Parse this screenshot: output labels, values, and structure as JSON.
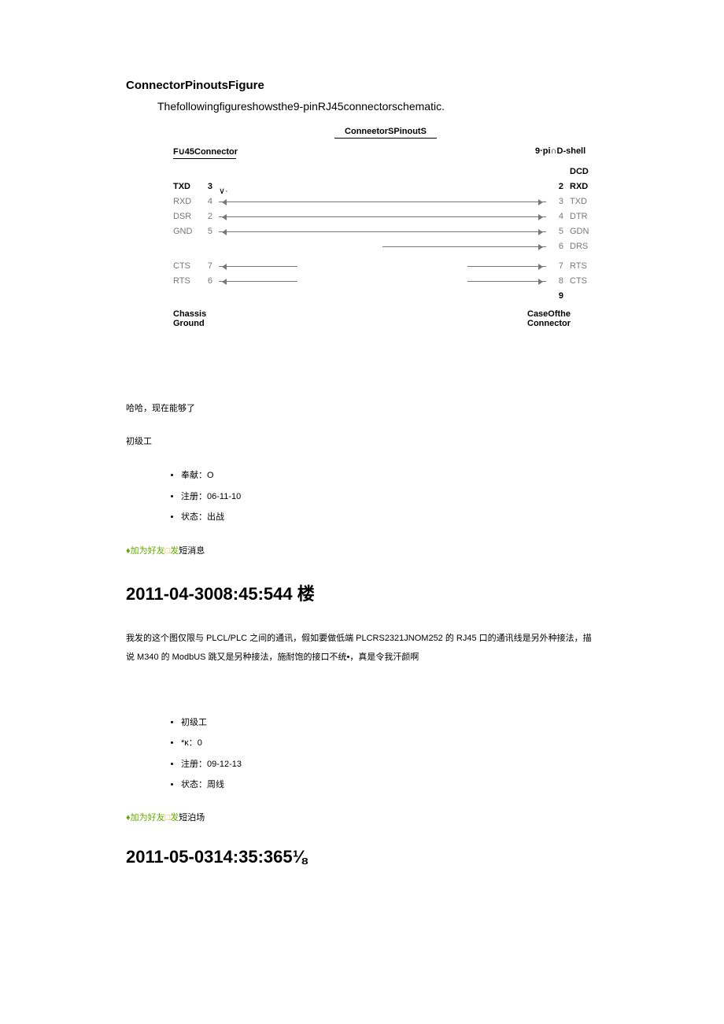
{
  "section_title": "ConnectorPinoutsFigure",
  "intro_text": "Thefollowingfigureshowsthe9-pinRJ45connectorschematic.",
  "diagram": {
    "title": "ConneetorSPinoutS",
    "left_header": "F∪45Connector",
    "right_header": "9·pi∩D-shell",
    "left_pins": [
      {
        "label": "TXD",
        "num": "3",
        "extra": "∨·"
      },
      {
        "label": "RXD",
        "num": "4"
      },
      {
        "label": "DSR",
        "num": "2"
      },
      {
        "label": "GND",
        "num": "5"
      },
      {
        "label": "",
        "num": ""
      },
      {
        "label": "CTS",
        "num": "7"
      },
      {
        "label": "RTS",
        "num": "6"
      }
    ],
    "right_pins": [
      {
        "num": "",
        "label": "DCD"
      },
      {
        "num": "2",
        "label": "RXD"
      },
      {
        "num": "3",
        "label": "TXD"
      },
      {
        "num": "4",
        "label": "DTR"
      },
      {
        "num": "5",
        "label": "GDN"
      },
      {
        "num": "6",
        "label": "DRS"
      },
      {
        "num": "7",
        "label": "RTS"
      },
      {
        "num": "8",
        "label": "CTS"
      },
      {
        "num": "9",
        "label": ""
      }
    ],
    "footer_left": "Chassis Ground",
    "footer_right": "CaseOfthe Connector"
  },
  "post3": {
    "reply_text": "哈哈，现在能够了",
    "rank": "初级工",
    "bullets": [
      "奉献：O",
      "注册：06-11-10",
      "状态：出战"
    ],
    "action_prefix": "♦",
    "action_add": "加为好友",
    "action_square": "□",
    "action_send": "发",
    "action_msg": "短消息"
  },
  "post4": {
    "heading": "2011-04-3008:45:544 楼",
    "body": "我发的这个图仅限与 PLCL/PLC 之间的通讯，假如要做低端 PLCRS2321JNOM252 的 RJ45 口的通讯线是另外种接法，描说 M340 的 ModbUS 跳又是另种接法，施耐饱的接口不统•，真是令我汗颜啊",
    "bullets": [
      "初级工",
      "*κ：0",
      "注册：09-12-13",
      "状态：周线"
    ],
    "action_prefix": "♦",
    "action_add": "加为好友",
    "action_square": "□",
    "action_send": "发",
    "action_msg": "短泊场"
  },
  "post5": {
    "heading": "2011-05-0314:35:365⅛"
  }
}
